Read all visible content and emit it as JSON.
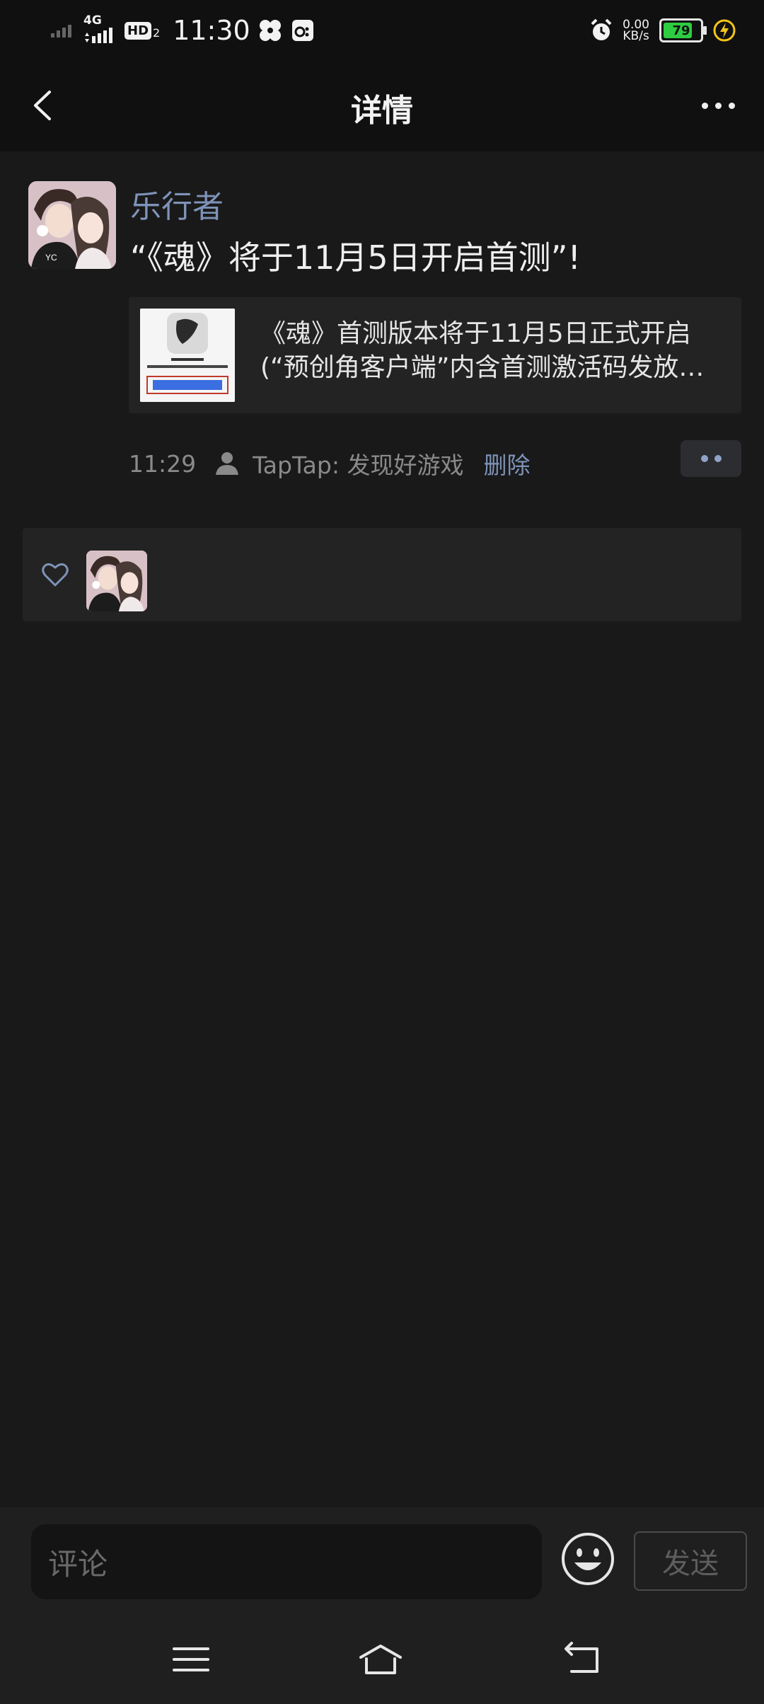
{
  "status_bar": {
    "network": "4G",
    "hd": "HD",
    "hd_sub": "2",
    "time": "11:30",
    "speed_value": "0.00",
    "speed_unit": "KB/s",
    "battery_level": 79,
    "battery_text": "79",
    "icons": [
      "signal-icon",
      "signal-4g-icon",
      "hd-voice-icon",
      "fan-icon",
      "gamepad-icon",
      "alarm-icon",
      "battery-icon",
      "charging-icon"
    ]
  },
  "header": {
    "title": "详情",
    "back_icon": "chevron-left-icon",
    "more_icon": "more-horizontal-icon"
  },
  "post": {
    "author": "乐行者",
    "text": "“《魂》将于11月5日开启首测”!",
    "share": {
      "title_line1": "《魂》首测版本将于11月5日正式开启",
      "title_line2": "(“预创角客户端”内含首测激活码发放…"
    },
    "time": "11:29",
    "source": "TapTap: 发现好游戏",
    "delete_label": "删除"
  },
  "likes": {
    "icon": "heart-icon"
  },
  "comment_bar": {
    "placeholder": "评论",
    "send_label": "发送",
    "emoji_icon": "smiley-icon"
  },
  "nav": {
    "icons": [
      "menu-icon",
      "home-icon",
      "back-icon"
    ]
  },
  "colors": {
    "background": "#191919",
    "header": "#101010",
    "link": "#7e93b8",
    "battery": "#2ecc40",
    "charging": "#f5c518"
  }
}
